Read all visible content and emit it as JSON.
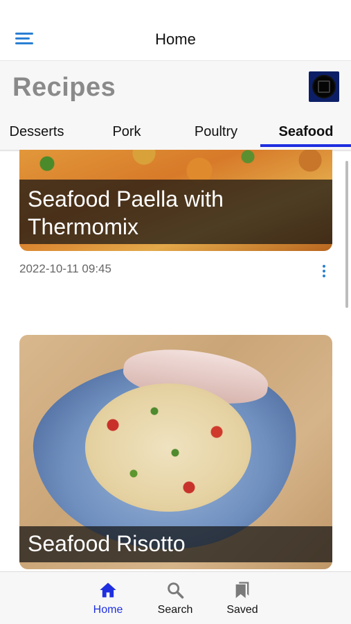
{
  "appbar": {
    "title": "Home"
  },
  "header": {
    "title": "Recipes",
    "tabs": [
      {
        "label": "Desserts"
      },
      {
        "label": "Pork"
      },
      {
        "label": "Poultry"
      },
      {
        "label": "Seafood",
        "active": true
      }
    ]
  },
  "recipes": [
    {
      "title": "Seafood Paella with Thermomix",
      "date": "2022-10-11 09:45"
    },
    {
      "title": "Seafood Risotto"
    }
  ],
  "bottom_nav": {
    "items": [
      {
        "label": "Home",
        "icon": "home-icon",
        "active": true
      },
      {
        "label": "Search",
        "icon": "search-icon"
      },
      {
        "label": "Saved",
        "icon": "bookmark-icon"
      }
    ]
  },
  "colors": {
    "accent": "#1f2fe0",
    "link": "#2a7fd4",
    "title_gray": "#8a8a8a"
  }
}
